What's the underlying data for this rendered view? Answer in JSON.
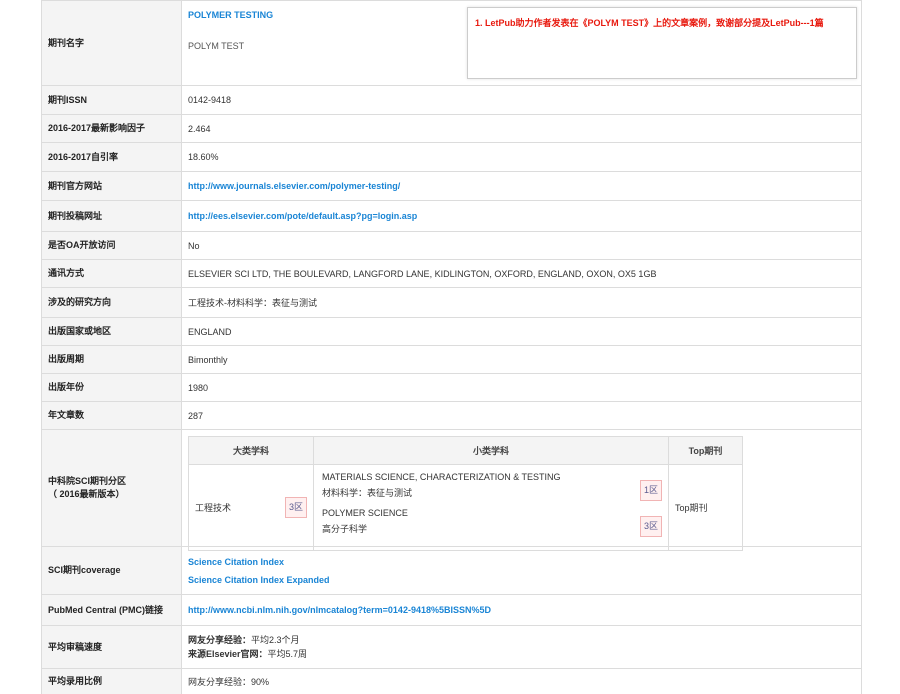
{
  "journal": {
    "label": "期刊名字",
    "full_name": "POLYMER TESTING",
    "abbr": "POLYM TEST",
    "notice": "1. LetPub助力作者发表在《POLYM TEST》上的文章案例，致谢部分提及LetPub---1篇"
  },
  "rows": {
    "issn": {
      "label": "期刊ISSN",
      "value": "0142-9418"
    },
    "impact": {
      "label": "2016-2017最新影响因子",
      "value": "2.464"
    },
    "self_cite": {
      "label": "2016-2017自引率",
      "value": "18.60%"
    },
    "website": {
      "label": "期刊官方网站",
      "value": "http://www.journals.elsevier.com/polymer-testing/"
    },
    "submit": {
      "label": "期刊投稿网址",
      "value": "http://ees.elsevier.com/pote/default.asp?pg=login.asp"
    },
    "oa": {
      "label": "是否OA开放访问",
      "value": "No"
    },
    "address": {
      "label": "通讯方式",
      "value": "ELSEVIER SCI LTD, THE BOULEVARD, LANGFORD LANE, KIDLINGTON, OXFORD, ENGLAND, OXON, OX5 1GB"
    },
    "field": {
      "label": "涉及的研究方向",
      "value": "工程技术-材料科学：表征与测试"
    },
    "country": {
      "label": "出版国家或地区",
      "value": "ENGLAND"
    },
    "period": {
      "label": "出版周期",
      "value": "Bimonthly"
    },
    "year": {
      "label": "出版年份",
      "value": "1980"
    },
    "articles": {
      "label": "年文章数",
      "value": "287"
    },
    "pmc": {
      "label": "PubMed Central (PMC)链接",
      "value": "http://www.ncbi.nlm.nih.gov/nlmcatalog?term=0142-9418%5BISSN%5D"
    },
    "review": {
      "label": "平均审稿速度",
      "line1_label": "网友分享经验：",
      "line1_value": "平均2.3个月",
      "line2_label": "来源Elsevier官网：",
      "line2_value": "平均5.7周"
    },
    "accept": {
      "label": "平均录用比例",
      "value": "网友分享经验：90%"
    }
  },
  "cas": {
    "label_line1": "中科院SCI期刊分区",
    "label_line2": "（ 2016最新版本）",
    "headers": {
      "major": "大类学科",
      "minor": "小类学科",
      "top": "Top期刊"
    },
    "major": {
      "name": "工程技术",
      "zone": "3区"
    },
    "minors": [
      {
        "en": "MATERIALS SCIENCE, CHARACTERIZATION & TESTING",
        "cn": "材料科学：表征与测试",
        "zone": "1区"
      },
      {
        "en": "POLYMER SCIENCE",
        "cn": "高分子科学",
        "zone": "3区"
      }
    ],
    "top": "Top期刊"
  },
  "coverage": {
    "label": "SCI期刊coverage",
    "items": [
      "Science Citation Index",
      "Science Citation Index Expanded"
    ]
  }
}
